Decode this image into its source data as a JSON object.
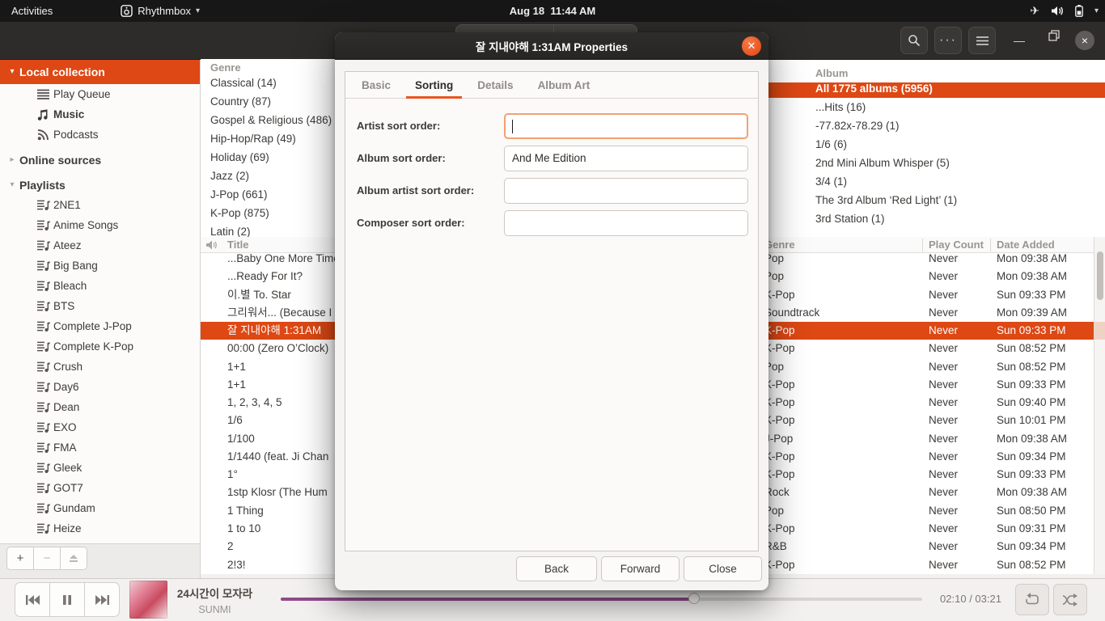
{
  "topbar": {
    "activities_label": "Activities",
    "app_menu_label": "Rhythmbox",
    "clock": "Aug 18  11:44 AM"
  },
  "sidebar": {
    "local_collection": "Local collection",
    "local_items": [
      {
        "label": "Play Queue",
        "icon": "play-queue-icon"
      },
      {
        "label": "Music",
        "icon": "music-note-icon",
        "current": true
      },
      {
        "label": "Podcasts",
        "icon": "podcasts-icon"
      }
    ],
    "online_sources": "Online sources",
    "playlists_header": "Playlists",
    "playlists": [
      "2NE1",
      "Anime Songs",
      "Ateez",
      "Big Bang",
      "Bleach",
      "BTS",
      "Complete J-Pop",
      "Complete K-Pop",
      "Crush",
      "Day6",
      "Dean",
      "EXO",
      "FMA",
      "Gleek",
      "GOT7",
      "Gundam",
      "Heize"
    ],
    "toolbar": {
      "add": "+",
      "remove": "−"
    }
  },
  "browser": {
    "genre": {
      "header": "Genre",
      "items": [
        "Classical (14)",
        "Country (87)",
        "Gospel & Religious (486)",
        "Hip-Hop/Rap (49)",
        "Holiday (69)",
        "Jazz (2)",
        "J-Pop (661)",
        "K-Pop (875)",
        "Latin (2)"
      ]
    },
    "album": {
      "header": "Album",
      "items": [
        {
          "label": "All 1775 albums (5956)",
          "selected": true
        },
        {
          "label": "...Hits (16)"
        },
        {
          "label": "-77.82x-78.29 (1)"
        },
        {
          "label": "1/6 (6)"
        },
        {
          "label": "2nd Mini Album Whisper (5)"
        },
        {
          "label": "3/4 (1)"
        },
        {
          "label": "The 3rd Album ‘Red Light’ (1)"
        },
        {
          "label": "3rd Station (1)"
        }
      ]
    }
  },
  "tracklist": {
    "columns": {
      "title": "Title",
      "genre": "Genre",
      "play_count": "Play Count",
      "date_added": "Date Added"
    },
    "rows": [
      {
        "title": "...Baby One More Time",
        "genre": "Pop",
        "play_count": "Never",
        "date_added": "Mon 09:38 AM"
      },
      {
        "title": "...Ready For It?",
        "genre": "Pop",
        "play_count": "Never",
        "date_added": "Mon 09:38 AM"
      },
      {
        "title": "이.별 To. Star",
        "genre": "K-Pop",
        "play_count": "Never",
        "date_added": "Sun 09:33 PM"
      },
      {
        "title": "그리워서... (Because I",
        "genre": "Soundtrack",
        "play_count": "Never",
        "date_added": "Mon 09:39 AM"
      },
      {
        "title": "잘 지내야해 1:31AM",
        "genre": "K-Pop",
        "play_count": "Never",
        "date_added": "Sun 09:33 PM",
        "selected": true
      },
      {
        "title": "00:00 (Zero O’Clock)",
        "genre": "K-Pop",
        "play_count": "Never",
        "date_added": "Sun 08:52 PM"
      },
      {
        "title": "1+1",
        "genre": "Pop",
        "play_count": "Never",
        "date_added": "Sun 08:52 PM"
      },
      {
        "title": "1+1",
        "genre": "K-Pop",
        "play_count": "Never",
        "date_added": "Sun 09:33 PM"
      },
      {
        "title": "1, 2, 3, 4, 5",
        "genre": "K-Pop",
        "play_count": "Never",
        "date_added": "Sun 09:40 PM"
      },
      {
        "title": "1/6",
        "genre": "K-Pop",
        "play_count": "Never",
        "date_added": "Sun 10:01 PM"
      },
      {
        "title": "1/100",
        "genre": "J-Pop",
        "play_count": "Never",
        "date_added": "Mon 09:38 AM"
      },
      {
        "title": "1/1440 (feat. Ji Chan",
        "genre": "K-Pop",
        "play_count": "Never",
        "date_added": "Sun 09:34 PM"
      },
      {
        "title": "1°",
        "genre": "K-Pop",
        "play_count": "Never",
        "date_added": "Sun 09:33 PM"
      },
      {
        "title": "1stp Klosr (The Hum",
        "genre": "Rock",
        "play_count": "Never",
        "date_added": "Mon 09:38 AM"
      },
      {
        "title": "1 Thing",
        "genre": "Pop",
        "play_count": "Never",
        "date_added": "Sun 08:50 PM"
      },
      {
        "title": "1 to 10",
        "genre": "K-Pop",
        "play_count": "Never",
        "date_added": "Sun 09:31 PM"
      },
      {
        "title": "2",
        "genre": "R&B",
        "play_count": "Never",
        "date_added": "Sun 09:34 PM"
      },
      {
        "title": "2!3!",
        "genre": "K-Pop",
        "play_count": "Never",
        "date_added": "Sun 08:52 PM"
      }
    ]
  },
  "player": {
    "track_title": "24시간이 모자라",
    "artist": "SUNMI",
    "time": "02:10 / 03:21",
    "progress_percent": 64.4
  },
  "dialog": {
    "title": "잘 지내야해 1:31AM Properties",
    "tabs": [
      {
        "label": "Basic"
      },
      {
        "label": "Sorting",
        "active": true
      },
      {
        "label": "Details"
      },
      {
        "label": "Album Art"
      }
    ],
    "fields": [
      {
        "label": "Artist sort order:",
        "value": "",
        "focused": true
      },
      {
        "label": "Album sort order:",
        "value": "And Me Edition"
      },
      {
        "label": "Album artist sort order:",
        "value": ""
      },
      {
        "label": "Composer sort order:",
        "value": ""
      }
    ],
    "buttons": [
      "Back",
      "Forward",
      "Close"
    ]
  },
  "colors": {
    "selection_orange": "#DD4814",
    "accent_orange": "#E95420",
    "progress_purple": "#8F4A8B"
  }
}
